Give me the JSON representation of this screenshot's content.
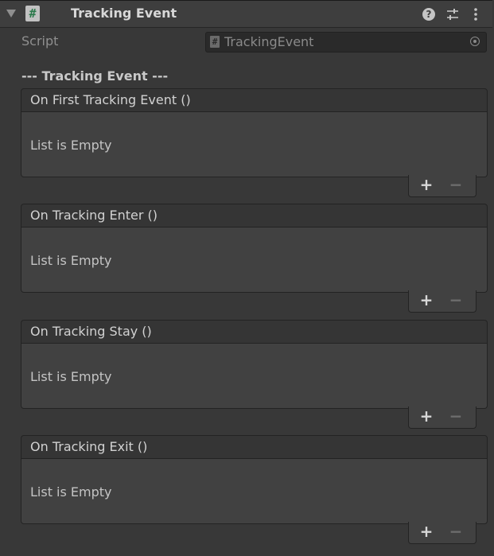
{
  "component": {
    "title": "Tracking Event",
    "script_icon_glyph": "#",
    "help_glyph": "?",
    "icons": [
      "foldout-arrow-icon",
      "script-icon",
      "help-icon",
      "presets-icon",
      "more-icon"
    ]
  },
  "script_row": {
    "label": "Script",
    "value": "TrackingEvent",
    "field_icon_glyph": "#"
  },
  "section_header": "--- Tracking Event ---",
  "events": [
    {
      "label": "On First Tracking Event ()",
      "empty_text": "List is Empty",
      "add": "+",
      "remove": "−"
    },
    {
      "label": "On Tracking Enter ()",
      "empty_text": "List is Empty",
      "add": "+",
      "remove": "−"
    },
    {
      "label": "On Tracking Stay ()",
      "empty_text": "List is Empty",
      "add": "+",
      "remove": "−"
    },
    {
      "label": "On Tracking Exit ()",
      "empty_text": "List is Empty",
      "add": "+",
      "remove": "−"
    }
  ],
  "colors": {
    "background": "#383838",
    "header_bg": "#3e3e3e",
    "event_header_bg": "#353535",
    "event_body_bg": "#414141",
    "field_bg": "#2a2a2a"
  }
}
